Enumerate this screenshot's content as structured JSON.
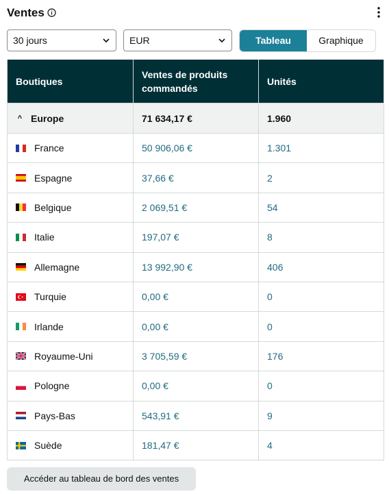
{
  "header": {
    "title": "Ventes"
  },
  "controls": {
    "period": "30 jours",
    "currency": "EUR",
    "view_toggle": {
      "table_label": "Tableau",
      "chart_label": "Graphique",
      "active": "Tableau"
    }
  },
  "colors": {
    "accent": "#1c8099",
    "header_bg": "#002f36",
    "value_text": "#1f6b80"
  },
  "table": {
    "headers": [
      "Boutiques",
      "Ventes de produits commandés",
      "Unités"
    ],
    "group": {
      "name": "Europe",
      "sales": "71 634,17 €",
      "units": "1.960"
    },
    "rows": [
      {
        "name": "France",
        "flag": "fr",
        "sales": "50 906,06 €",
        "units": "1.301"
      },
      {
        "name": "Espagne",
        "flag": "es",
        "sales": "37,66 €",
        "units": "2"
      },
      {
        "name": "Belgique",
        "flag": "be",
        "sales": "2 069,51 €",
        "units": "54"
      },
      {
        "name": "Italie",
        "flag": "it",
        "sales": "197,07 €",
        "units": "8"
      },
      {
        "name": "Allemagne",
        "flag": "de",
        "sales": "13 992,90 €",
        "units": "406"
      },
      {
        "name": "Turquie",
        "flag": "tr",
        "sales": "0,00 €",
        "units": "0"
      },
      {
        "name": "Irlande",
        "flag": "ie",
        "sales": "0,00 €",
        "units": "0"
      },
      {
        "name": "Royaume-Uni",
        "flag": "gb",
        "sales": "3 705,59 €",
        "units": "176"
      },
      {
        "name": "Pologne",
        "flag": "pl",
        "sales": "0,00 €",
        "units": "0"
      },
      {
        "name": "Pays-Bas",
        "flag": "nl",
        "sales": "543,91 €",
        "units": "9"
      },
      {
        "name": "Suède",
        "flag": "se",
        "sales": "181,47 €",
        "units": "4"
      }
    ]
  },
  "footer": {
    "button_label": "Accéder au tableau de bord des ventes"
  }
}
